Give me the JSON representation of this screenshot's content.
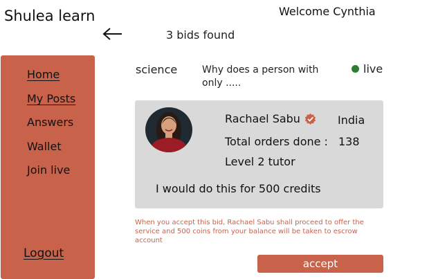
{
  "header": {
    "brand": "Shulea learn",
    "welcome": "Welcome Cynthia",
    "back_icon": "arrow-left-icon",
    "bids_found": "3 bids found"
  },
  "sidebar": {
    "items": [
      {
        "label": "Home",
        "underlined": true
      },
      {
        "label": "My Posts",
        "underlined": true
      },
      {
        "label": "Answers",
        "underlined": false
      },
      {
        "label": "Wallet",
        "underlined": false
      },
      {
        "label": "Join live",
        "underlined": false
      }
    ],
    "logout": "Logout"
  },
  "post": {
    "subject": "science",
    "question": "Why does a person with only .....",
    "status": "live",
    "status_color": "#2e7d32"
  },
  "bid": {
    "tutor_name": "Rachael Sabu",
    "verified_icon": "verified-badge-icon",
    "country": "India",
    "orders_label": "Total orders done :",
    "orders_value": "138",
    "level": "Level 2 tutor",
    "offer": "I would do this for 500 credits"
  },
  "notice": "When you accept this bid, Rachael Sabu shall proceed to offer the service and 500 coins from your balance  will be taken to escrow account",
  "accept_label": "accept",
  "colors": {
    "accent": "#c8624a",
    "card": "#d9d9d9"
  }
}
